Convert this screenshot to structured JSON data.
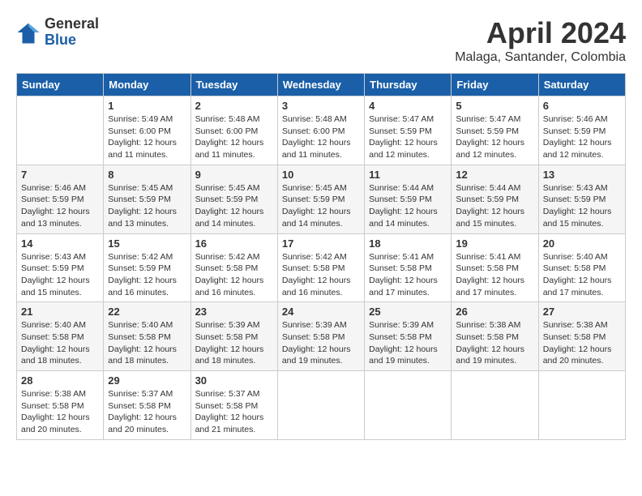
{
  "logo": {
    "general": "General",
    "blue": "Blue"
  },
  "header": {
    "month": "April 2024",
    "location": "Malaga, Santander, Colombia"
  },
  "weekdays": [
    "Sunday",
    "Monday",
    "Tuesday",
    "Wednesday",
    "Thursday",
    "Friday",
    "Saturday"
  ],
  "weeks": [
    [
      {
        "day": "",
        "info": ""
      },
      {
        "day": "1",
        "info": "Sunrise: 5:49 AM\nSunset: 6:00 PM\nDaylight: 12 hours\nand 11 minutes."
      },
      {
        "day": "2",
        "info": "Sunrise: 5:48 AM\nSunset: 6:00 PM\nDaylight: 12 hours\nand 11 minutes."
      },
      {
        "day": "3",
        "info": "Sunrise: 5:48 AM\nSunset: 6:00 PM\nDaylight: 12 hours\nand 11 minutes."
      },
      {
        "day": "4",
        "info": "Sunrise: 5:47 AM\nSunset: 5:59 PM\nDaylight: 12 hours\nand 12 minutes."
      },
      {
        "day": "5",
        "info": "Sunrise: 5:47 AM\nSunset: 5:59 PM\nDaylight: 12 hours\nand 12 minutes."
      },
      {
        "day": "6",
        "info": "Sunrise: 5:46 AM\nSunset: 5:59 PM\nDaylight: 12 hours\nand 12 minutes."
      }
    ],
    [
      {
        "day": "7",
        "info": "Sunrise: 5:46 AM\nSunset: 5:59 PM\nDaylight: 12 hours\nand 13 minutes."
      },
      {
        "day": "8",
        "info": "Sunrise: 5:45 AM\nSunset: 5:59 PM\nDaylight: 12 hours\nand 13 minutes."
      },
      {
        "day": "9",
        "info": "Sunrise: 5:45 AM\nSunset: 5:59 PM\nDaylight: 12 hours\nand 14 minutes."
      },
      {
        "day": "10",
        "info": "Sunrise: 5:45 AM\nSunset: 5:59 PM\nDaylight: 12 hours\nand 14 minutes."
      },
      {
        "day": "11",
        "info": "Sunrise: 5:44 AM\nSunset: 5:59 PM\nDaylight: 12 hours\nand 14 minutes."
      },
      {
        "day": "12",
        "info": "Sunrise: 5:44 AM\nSunset: 5:59 PM\nDaylight: 12 hours\nand 15 minutes."
      },
      {
        "day": "13",
        "info": "Sunrise: 5:43 AM\nSunset: 5:59 PM\nDaylight: 12 hours\nand 15 minutes."
      }
    ],
    [
      {
        "day": "14",
        "info": "Sunrise: 5:43 AM\nSunset: 5:59 PM\nDaylight: 12 hours\nand 15 minutes."
      },
      {
        "day": "15",
        "info": "Sunrise: 5:42 AM\nSunset: 5:59 PM\nDaylight: 12 hours\nand 16 minutes."
      },
      {
        "day": "16",
        "info": "Sunrise: 5:42 AM\nSunset: 5:58 PM\nDaylight: 12 hours\nand 16 minutes."
      },
      {
        "day": "17",
        "info": "Sunrise: 5:42 AM\nSunset: 5:58 PM\nDaylight: 12 hours\nand 16 minutes."
      },
      {
        "day": "18",
        "info": "Sunrise: 5:41 AM\nSunset: 5:58 PM\nDaylight: 12 hours\nand 17 minutes."
      },
      {
        "day": "19",
        "info": "Sunrise: 5:41 AM\nSunset: 5:58 PM\nDaylight: 12 hours\nand 17 minutes."
      },
      {
        "day": "20",
        "info": "Sunrise: 5:40 AM\nSunset: 5:58 PM\nDaylight: 12 hours\nand 17 minutes."
      }
    ],
    [
      {
        "day": "21",
        "info": "Sunrise: 5:40 AM\nSunset: 5:58 PM\nDaylight: 12 hours\nand 18 minutes."
      },
      {
        "day": "22",
        "info": "Sunrise: 5:40 AM\nSunset: 5:58 PM\nDaylight: 12 hours\nand 18 minutes."
      },
      {
        "day": "23",
        "info": "Sunrise: 5:39 AM\nSunset: 5:58 PM\nDaylight: 12 hours\nand 18 minutes."
      },
      {
        "day": "24",
        "info": "Sunrise: 5:39 AM\nSunset: 5:58 PM\nDaylight: 12 hours\nand 19 minutes."
      },
      {
        "day": "25",
        "info": "Sunrise: 5:39 AM\nSunset: 5:58 PM\nDaylight: 12 hours\nand 19 minutes."
      },
      {
        "day": "26",
        "info": "Sunrise: 5:38 AM\nSunset: 5:58 PM\nDaylight: 12 hours\nand 19 minutes."
      },
      {
        "day": "27",
        "info": "Sunrise: 5:38 AM\nSunset: 5:58 PM\nDaylight: 12 hours\nand 20 minutes."
      }
    ],
    [
      {
        "day": "28",
        "info": "Sunrise: 5:38 AM\nSunset: 5:58 PM\nDaylight: 12 hours\nand 20 minutes."
      },
      {
        "day": "29",
        "info": "Sunrise: 5:37 AM\nSunset: 5:58 PM\nDaylight: 12 hours\nand 20 minutes."
      },
      {
        "day": "30",
        "info": "Sunrise: 5:37 AM\nSunset: 5:58 PM\nDaylight: 12 hours\nand 21 minutes."
      },
      {
        "day": "",
        "info": ""
      },
      {
        "day": "",
        "info": ""
      },
      {
        "day": "",
        "info": ""
      },
      {
        "day": "",
        "info": ""
      }
    ]
  ]
}
